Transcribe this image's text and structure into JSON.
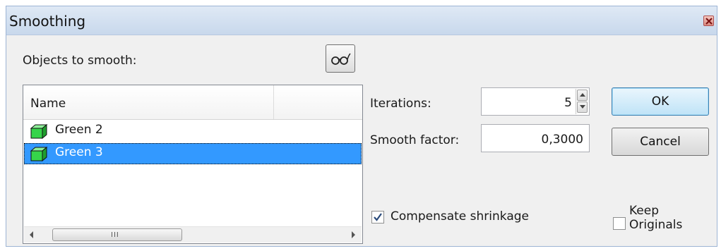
{
  "window": {
    "title": "Smoothing"
  },
  "objects": {
    "label": "Objects to smooth:",
    "column_name": "Name",
    "items": [
      {
        "label": "Green 2",
        "selected": false
      },
      {
        "label": "Green 3",
        "selected": true
      }
    ],
    "scroll_grip": "III"
  },
  "iterations": {
    "label": "Iterations:",
    "value": "5"
  },
  "smooth_factor": {
    "label": "Smooth factor:",
    "value": "0,3000"
  },
  "buttons": {
    "ok": "OK",
    "cancel": "Cancel"
  },
  "options": {
    "compensate_shrinkage": {
      "label": "Compensate shrinkage",
      "checked": true
    },
    "keep_originals": {
      "label_line1": "Keep",
      "label_line2": "Originals",
      "checked": false
    }
  },
  "colors": {
    "selection": "#3399ff",
    "cube_green": "#36d44a",
    "default_button": "#bfe3f7"
  },
  "icons": [
    "glasses-icon",
    "close-icon",
    "cube-icon",
    "spin-up-icon",
    "spin-down-icon",
    "checkmark-icon"
  ]
}
